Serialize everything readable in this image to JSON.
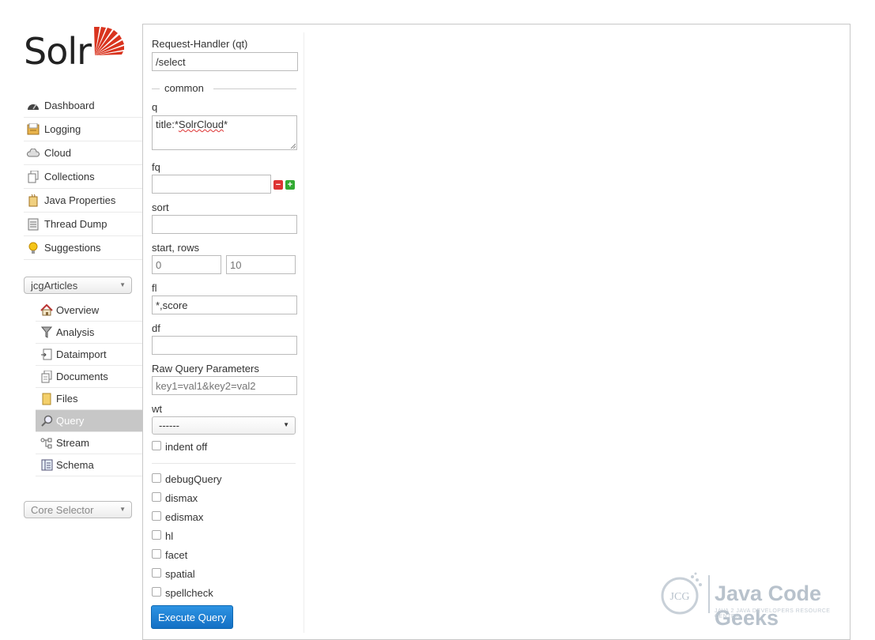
{
  "logo": {
    "text": "Solr"
  },
  "nav": [
    {
      "label": "Dashboard",
      "icon": "dashboard-icon"
    },
    {
      "label": "Logging",
      "icon": "logging-icon"
    },
    {
      "label": "Cloud",
      "icon": "cloud-icon"
    },
    {
      "label": "Collections",
      "icon": "collections-icon"
    },
    {
      "label": "Java Properties",
      "icon": "java-properties-icon"
    },
    {
      "label": "Thread Dump",
      "icon": "thread-dump-icon"
    },
    {
      "label": "Suggestions",
      "icon": "lightbulb-icon"
    }
  ],
  "core_select": {
    "value": "jcgArticles"
  },
  "core_menu": [
    {
      "label": "Overview",
      "icon": "house-icon"
    },
    {
      "label": "Analysis",
      "icon": "funnel-icon"
    },
    {
      "label": "Dataimport",
      "icon": "dataimport-icon"
    },
    {
      "label": "Documents",
      "icon": "documents-icon"
    },
    {
      "label": "Files",
      "icon": "folder-icon"
    },
    {
      "label": "Query",
      "icon": "magnifier-icon",
      "active": true
    },
    {
      "label": "Stream",
      "icon": "stream-icon"
    },
    {
      "label": "Schema",
      "icon": "schema-icon"
    }
  ],
  "core_selector": {
    "placeholder": "Core Selector"
  },
  "form": {
    "request_handler_label": "Request-Handler (qt)",
    "request_handler_value": "/select",
    "common_legend": "common",
    "q_label": "q",
    "q_value_prefix": "title:*",
    "q_value_word": "SolrCloud",
    "q_value_suffix": "*",
    "fq_label": "fq",
    "sort_label": "sort",
    "start_rows_label": "start, rows",
    "start_placeholder": "0",
    "rows_placeholder": "10",
    "fl_label": "fl",
    "fl_value": "*,score",
    "df_label": "df",
    "raw_label": "Raw Query Parameters",
    "raw_placeholder": "key1=val1&key2=val2",
    "wt_label": "wt",
    "wt_value": "------",
    "indent_label": "indent off",
    "options": [
      "debugQuery",
      "dismax",
      "edismax",
      "hl",
      "facet",
      "spatial",
      "spellcheck"
    ],
    "execute_label": "Execute Query"
  },
  "watermark": {
    "brand": "Java Code Geeks",
    "tagline": "JAVA 2 JAVA DEVELOPERS RESOURCE CENTER",
    "badge": "JCG"
  },
  "colors": {
    "accent": "#1a7bd2",
    "logo_red": "#d9341f",
    "active_nav": "#c7c7c7"
  }
}
